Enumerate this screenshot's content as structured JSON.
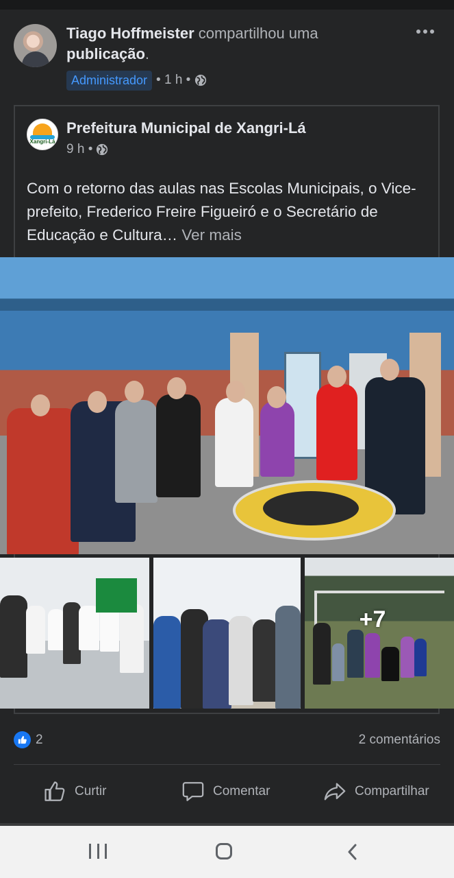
{
  "post": {
    "author": "Tiago Hoffmeister",
    "action": " compartilhou uma ",
    "object": "publicação",
    "period": ".",
    "role_badge": "Administrador",
    "time": "• 1 h •",
    "visibility_icon": "globe-icon",
    "more_icon": "more-options-icon"
  },
  "shared": {
    "page_name": "Prefeitura Municipal de Xangri-Lá",
    "logo_text": "Xangri-Lá",
    "time": "9 h •",
    "text": "Com o retorno das aulas nas Escolas Municipais, o Vice-prefeito, Frederico Freire Figueiró e o Secretário de Educação e Cultura…",
    "see_more": " Ver mais",
    "extra_photos": "+7"
  },
  "reactions": {
    "likes": "2",
    "comments": "2 comentários"
  },
  "actions": {
    "like": "Curtir",
    "comment": "Comentar",
    "share": "Compartilhar"
  },
  "colors": {
    "background": "#242526",
    "accent": "#1877f2",
    "badge_bg": "#263951",
    "badge_text": "#4599ff"
  }
}
